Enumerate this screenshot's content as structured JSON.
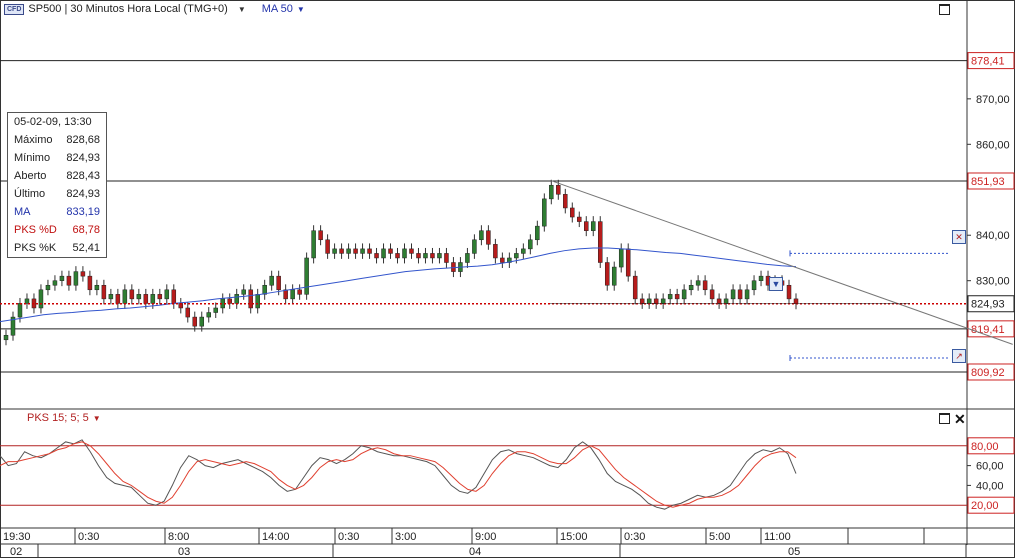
{
  "header": {
    "badge": "CFD",
    "symbol": "SP500 | 30 Minutos Hora Local (TMG+0)",
    "ma_label": "MA 50"
  },
  "indicator_header": {
    "label": "PKS 15; 5; 5"
  },
  "info_box": {
    "datetime": "05-02-09, 13:30",
    "rows": [
      {
        "label": "Máximo",
        "value": "828,68",
        "style": "normal"
      },
      {
        "label": "Mínimo",
        "value": "824,93",
        "style": "normal"
      },
      {
        "label": "Aberto",
        "value": "828,43",
        "style": "normal"
      },
      {
        "label": "Último",
        "value": "824,93",
        "style": "normal"
      },
      {
        "label": "MA",
        "value": "833,19",
        "style": "blue"
      },
      {
        "label": "PKS %D",
        "value": "68,78",
        "style": "red"
      },
      {
        "label": "PKS %K",
        "value": "52,41",
        "style": "normal"
      }
    ]
  },
  "colors": {
    "up_candle": "#2e7d32",
    "down_candle": "#b71c1c",
    "ma_line": "#3355cc",
    "last_price_line": "#cc0000",
    "stoch_d": "#e04030",
    "stoch_k": "#555555",
    "level_box": "#cc2222"
  },
  "chart_data": [
    {
      "type": "candlestick",
      "title": "SP500 | 30 Minutos Hora Local (TMG+0)",
      "ylim": [
        802,
        888
      ],
      "y_ticks": [
        {
          "value": 870,
          "label": "870,00"
        },
        {
          "value": 860,
          "label": "860,00"
        },
        {
          "value": 840,
          "label": "840,00"
        },
        {
          "value": 830,
          "label": "830,00"
        }
      ],
      "horizontal_levels": [
        {
          "value": 878.41,
          "label": "878,41"
        },
        {
          "value": 851.93,
          "label": "851,93"
        },
        {
          "value": 819.41,
          "label": "819,41"
        },
        {
          "value": 809.92,
          "label": "809,92"
        }
      ],
      "last_price": {
        "value": 824.93,
        "label": "824,93"
      },
      "x_labels_top": [
        "19:30",
        "0:30",
        "8:00",
        "14:00",
        "0:30",
        "3:00",
        "9:00",
        "15:00",
        "0:30",
        "5:00",
        "11:00"
      ],
      "x_labels_bottom": [
        "02",
        "03",
        "04",
        "05"
      ],
      "closes": [
        818,
        822,
        825,
        826,
        824,
        828,
        829,
        830,
        831,
        829,
        832,
        831,
        828,
        829,
        826,
        827,
        825,
        828,
        826,
        827,
        825,
        827,
        826,
        828,
        825,
        824,
        822,
        820,
        822,
        823,
        824,
        826,
        825,
        827,
        828,
        824,
        827,
        829,
        831,
        828,
        826,
        828,
        827,
        835,
        841,
        839,
        836,
        837,
        836,
        837,
        836,
        837,
        836,
        835,
        837,
        836,
        835,
        837,
        836,
        835,
        836,
        835,
        836,
        834,
        832,
        834,
        836,
        839,
        841,
        838,
        835,
        834,
        835,
        836,
        837,
        839,
        842,
        848,
        851,
        849,
        846,
        844,
        843,
        841,
        843,
        834,
        829,
        833,
        837,
        831,
        826,
        825,
        826,
        825,
        826,
        827,
        826,
        828,
        829,
        830,
        828,
        826,
        825,
        826,
        828,
        826,
        828,
        830,
        831,
        829,
        830,
        829,
        826,
        824.93
      ],
      "ma50": [
        821,
        821.5,
        822,
        822.5,
        822.8,
        823,
        823.3,
        823.5,
        823.8,
        824,
        824.3,
        824.6,
        825,
        825.3,
        825.6,
        826,
        826.3,
        826.6,
        827,
        827.5,
        828,
        828.5,
        829,
        829.5,
        830,
        830.5,
        831,
        831.5,
        832,
        832.3,
        832.6,
        832.8,
        833,
        833.2,
        833.5,
        834,
        834.6,
        835.3,
        836,
        836.6,
        837,
        837.2,
        837.2,
        837,
        836.8,
        836.5,
        836.2,
        836,
        835.6,
        835.2,
        834.8,
        834.4,
        834,
        833.6,
        833.3,
        833.1
      ],
      "trendline": {
        "from": {
          "candle": 78,
          "value": 852
        },
        "to": {
          "candle": 144,
          "value": 816
        }
      },
      "price_targets": [
        836,
        813
      ]
    },
    {
      "type": "line",
      "title": "PKS 15; 5; 5",
      "ylim": [
        0,
        100
      ],
      "y_ticks": [
        {
          "value": 60,
          "label": "60,00"
        },
        {
          "value": 40,
          "label": "40,00"
        }
      ],
      "horizontal_levels": [
        {
          "value": 80,
          "label": "80,00"
        },
        {
          "value": 20,
          "label": "20,00"
        }
      ],
      "series": [
        {
          "name": "PKS %K",
          "values": [
            70,
            60,
            62,
            74,
            70,
            68,
            72,
            78,
            84,
            82,
            86,
            74,
            60,
            48,
            42,
            40,
            38,
            30,
            22,
            20,
            24,
            40,
            58,
            70,
            66,
            60,
            58,
            62,
            64,
            66,
            62,
            58,
            54,
            48,
            40,
            34,
            36,
            48,
            60,
            68,
            66,
            62,
            66,
            72,
            80,
            78,
            74,
            72,
            70,
            70,
            68,
            66,
            64,
            60,
            50,
            40,
            34,
            32,
            38,
            52,
            66,
            74,
            76,
            72,
            70,
            68,
            64,
            60,
            58,
            66,
            78,
            84,
            78,
            66,
            52,
            44,
            40,
            36,
            30,
            22,
            18,
            16,
            20,
            22,
            26,
            30,
            28,
            30,
            34,
            40,
            52,
            64,
            72,
            76,
            74,
            78,
            72,
            52
          ]
        },
        {
          "name": "PKS %D",
          "values": [
            60,
            64,
            64,
            66,
            68,
            70,
            72,
            76,
            78,
            82,
            84,
            80,
            72,
            62,
            52,
            44,
            40,
            34,
            28,
            24,
            22,
            28,
            40,
            54,
            64,
            66,
            64,
            62,
            60,
            62,
            64,
            62,
            58,
            54,
            46,
            40,
            36,
            40,
            48,
            58,
            64,
            66,
            64,
            66,
            72,
            76,
            78,
            76,
            72,
            70,
            70,
            68,
            66,
            64,
            58,
            50,
            42,
            36,
            34,
            40,
            52,
            62,
            70,
            74,
            74,
            72,
            68,
            64,
            62,
            62,
            68,
            76,
            80,
            76,
            66,
            56,
            48,
            42,
            36,
            30,
            24,
            20,
            18,
            20,
            22,
            26,
            28,
            28,
            30,
            34,
            40,
            50,
            60,
            68,
            72,
            74,
            74,
            68
          ]
        }
      ]
    }
  ]
}
